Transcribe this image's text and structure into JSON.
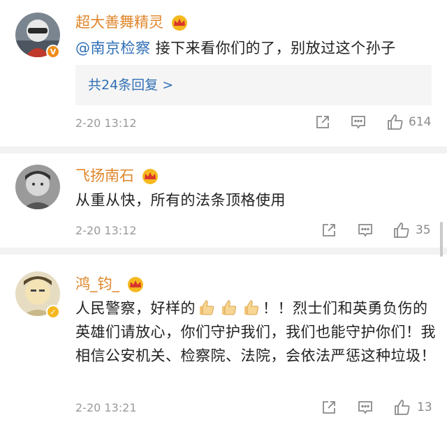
{
  "comments": [
    {
      "username": "超大善舞精灵",
      "mention": "@南京检察",
      "text": " 接下来看你们的了，别放过这个孙子",
      "replies_link": "共24条回复 >",
      "time": "2-20 13:12",
      "likes": "614"
    },
    {
      "username": "飞扬南石",
      "text": "从重从快，所有的法条顶格使用",
      "time": "2-20 13:12",
      "likes": "35"
    },
    {
      "username": "鸿_钧_",
      "text_part1": "人民警察，好样的",
      "text_part2": "！！烈士们和英勇负伤的英雄们请放心，你们守护我们，我们也能守护你们！我相信公安机关、检察院、法院，会依法严惩这种垃圾！",
      "time": "2-20 13:21",
      "likes": "13"
    }
  ],
  "icons": {
    "share": "share-icon",
    "comment": "comment-icon",
    "like": "thumbs-up-icon",
    "crown": "crown-icon",
    "verified": "verified-icon"
  },
  "colors": {
    "username": "#e0862b",
    "link": "#2f6fb5",
    "meta": "#9a9a9a",
    "divider": "#f2f2f2"
  }
}
